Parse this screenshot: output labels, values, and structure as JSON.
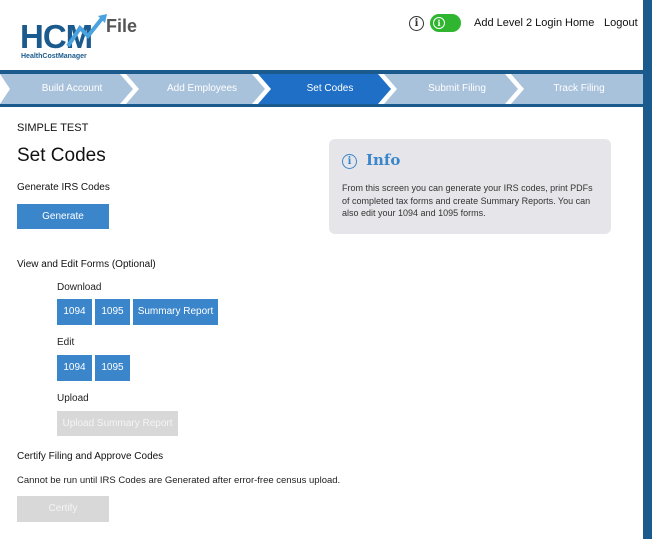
{
  "header": {
    "logo_text": "HCM",
    "logo_word": "File",
    "logo_tagline": "HealthCostManager",
    "info_icon": "info-circle-icon",
    "toggle_icon": "info-circle-icon",
    "links": [
      "Add Level 2 Login",
      "Home",
      "Logout"
    ]
  },
  "steps": [
    {
      "label": "Build Account",
      "active": false
    },
    {
      "label": "Add Employees",
      "active": false
    },
    {
      "label": "Set Codes",
      "active": true
    },
    {
      "label": "Submit Filing",
      "active": false
    },
    {
      "label": "Track Filing",
      "active": false
    }
  ],
  "main": {
    "company": "SIMPLE TEST",
    "title": "Set Codes",
    "generate_section": "Generate IRS Codes",
    "generate_button": "Generate",
    "view_edit_section": "View and Edit Forms (Optional)",
    "download_label": "Download",
    "download_buttons": [
      "1094",
      "1095",
      "Summary Report"
    ],
    "edit_label": "Edit",
    "edit_buttons": [
      "1094",
      "1095"
    ],
    "upload_label": "Upload",
    "upload_button": "Upload Summary Report",
    "certify_section": "Certify Filing and Approve Codes",
    "certify_note": "Cannot be run until IRS Codes are Generated after error-free census upload.",
    "certify_button": "Certify"
  },
  "info": {
    "title": "Info",
    "text": "From this screen you can generate your IRS codes, print PDFs of completed tax forms and create Summary Reports. You can also edit your 1094 and 1095 forms."
  },
  "colors": {
    "brand_blue": "#1b5a8c",
    "button_blue": "#3b86cb",
    "step_inactive": "#a9c2dc",
    "step_active": "#1f6fc6",
    "toggle_green": "#2fb52f",
    "disabled_gray": "#d8d8d8"
  }
}
